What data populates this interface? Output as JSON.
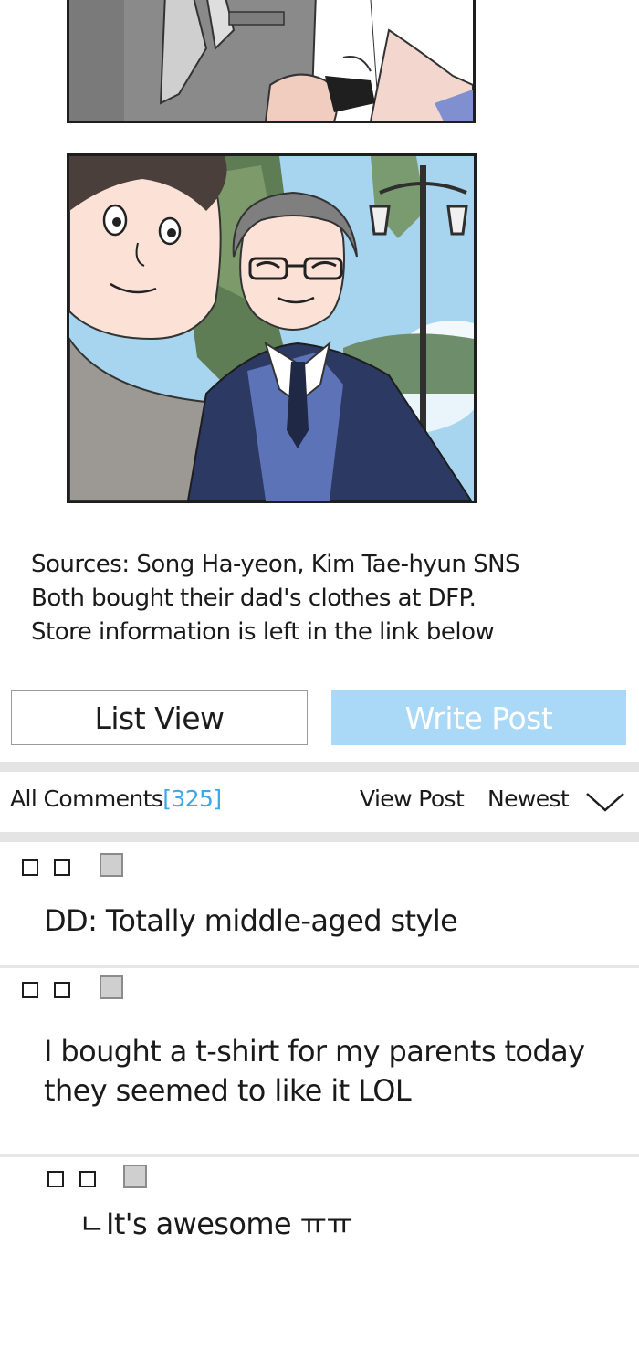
{
  "caption": {
    "line1": "Sources: Song Ha-yeon, Kim Tae-hyun SNS",
    "line2": "Both bought their dad's clothes at DFP.",
    "line3": "Store information is left in the link below"
  },
  "buttons": {
    "list_view": "List View",
    "write_post": "Write Post"
  },
  "comments_bar": {
    "label": "All Comments",
    "count": "[325]",
    "view_post": "View Post",
    "sort": "Newest"
  },
  "comments": [
    {
      "author": "□ □",
      "text": "DD: Totally middle-aged style"
    },
    {
      "author": "□ □",
      "line1": "I bought a t-shirt for my parents today",
      "line2": "they seemed to like it LOL"
    },
    {
      "author": "□ □",
      "reply_marker": "ㄴ",
      "text": "It's awesome ㅠㅠ"
    }
  ],
  "colors": {
    "accent_blue": "#3fa6e8",
    "write_button": "#a9d9f6",
    "divider": "#e4e4e4"
  },
  "icons": [
    "chevron-down-icon",
    "avatar-icon"
  ]
}
